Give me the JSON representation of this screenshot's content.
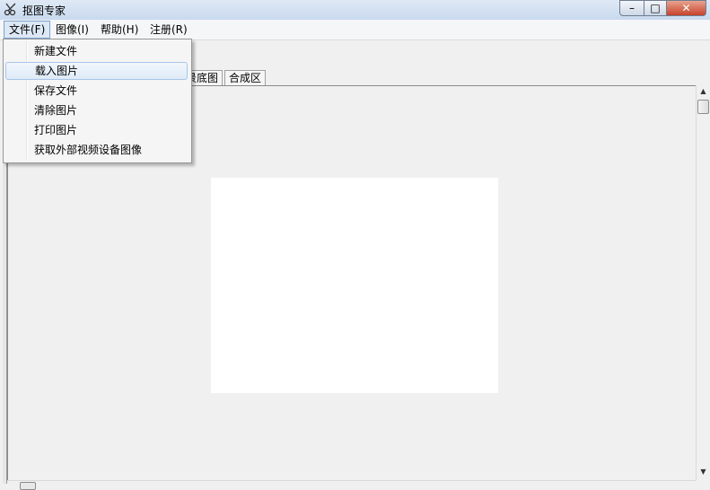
{
  "window": {
    "title": "抠图专家",
    "minimize_symbol": "–",
    "maximize_symbol": "□",
    "close_symbol": "✕"
  },
  "menubar": {
    "file": "文件(F)",
    "image": "图像(I)",
    "help": "帮助(H)",
    "register": "注册(R)"
  },
  "file_menu": {
    "items": [
      {
        "label": "新建文件"
      },
      {
        "label": "载入图片"
      },
      {
        "label": "保存文件"
      },
      {
        "label": "清除图片"
      },
      {
        "label": "打印图片"
      },
      {
        "label": "获取外部视频设备图像"
      }
    ],
    "highlighted_index": 1
  },
  "tabs": {
    "background_partial": "景底图",
    "composite": "合成区"
  },
  "scroll": {
    "up_arrow": "▲",
    "down_arrow": "▼"
  }
}
